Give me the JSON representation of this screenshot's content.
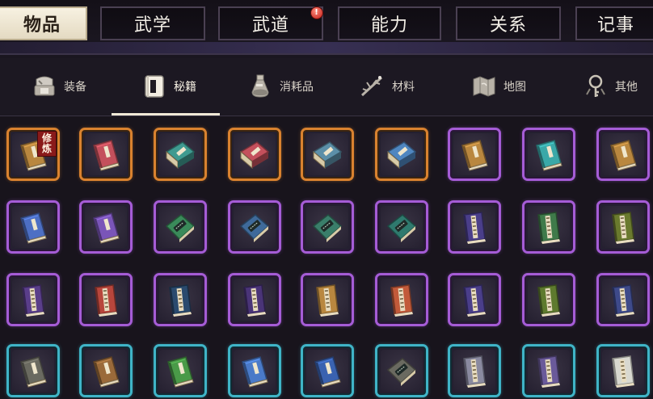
{
  "top_tabs": [
    {
      "label": "物品",
      "active": true
    },
    {
      "label": "武学",
      "active": false
    },
    {
      "label": "武道",
      "active": false,
      "badge": "!"
    },
    {
      "label": "能力",
      "active": false
    },
    {
      "label": "关系",
      "active": false
    },
    {
      "label": "记事",
      "active": false
    }
  ],
  "categories": [
    {
      "label": "装备",
      "icon": "equipment-icon",
      "active": false
    },
    {
      "label": "秘籍",
      "icon": "scroll-book-icon",
      "active": true
    },
    {
      "label": "消耗品",
      "icon": "potion-icon",
      "active": false
    },
    {
      "label": "材料",
      "icon": "herb-icon",
      "active": false
    },
    {
      "label": "地图",
      "icon": "map-icon",
      "active": false
    },
    {
      "label": "其他",
      "icon": "key-ring-icon",
      "active": false
    }
  ],
  "items": [
    {
      "rarity": "orange",
      "style": "thin",
      "cover": "#b9873f",
      "tag": "修炼"
    },
    {
      "rarity": "orange",
      "style": "thin",
      "cover": "#c4505c"
    },
    {
      "rarity": "orange",
      "style": "thick",
      "cover": "#3f9a90"
    },
    {
      "rarity": "orange",
      "style": "thick",
      "cover": "#c4505c"
    },
    {
      "rarity": "orange",
      "style": "thick",
      "cover": "#5c8fa8"
    },
    {
      "rarity": "orange",
      "style": "thick",
      "cover": "#4f86c0"
    },
    {
      "rarity": "purple",
      "style": "thin",
      "cover": "#b9873f"
    },
    {
      "rarity": "purple",
      "style": "thin",
      "cover": "#3aa8a8"
    },
    {
      "rarity": "purple",
      "style": "thin",
      "cover": "#b9873f"
    },
    {
      "rarity": "purple",
      "style": "thin",
      "cover": "#4d6fc4"
    },
    {
      "rarity": "purple",
      "style": "thin",
      "cover": "#7a55b8"
    },
    {
      "rarity": "purple",
      "style": "plate",
      "cover": "#3a8a5a"
    },
    {
      "rarity": "purple",
      "style": "plate",
      "cover": "#3f6a9a"
    },
    {
      "rarity": "purple",
      "style": "plate",
      "cover": "#3a7e6a"
    },
    {
      "rarity": "purple",
      "style": "plate",
      "cover": "#2f7a6e"
    },
    {
      "rarity": "purple",
      "style": "stitch",
      "cover": "#4a3e8a"
    },
    {
      "rarity": "purple",
      "style": "stitch",
      "cover": "#3f7a4a"
    },
    {
      "rarity": "purple",
      "style": "stitch",
      "cover": "#6a7a2e"
    },
    {
      "rarity": "purple",
      "style": "stitch",
      "cover": "#5a3e8a"
    },
    {
      "rarity": "purple",
      "style": "stitch",
      "cover": "#b8463c"
    },
    {
      "rarity": "purple",
      "style": "stitch",
      "cover": "#2a4a6e"
    },
    {
      "rarity": "purple",
      "style": "stitch",
      "cover": "#4a3478"
    },
    {
      "rarity": "purple",
      "style": "stitch",
      "cover": "#b9873f"
    },
    {
      "rarity": "purple",
      "style": "stitch",
      "cover": "#c25a3a"
    },
    {
      "rarity": "purple",
      "style": "stitch",
      "cover": "#4a3e8a"
    },
    {
      "rarity": "purple",
      "style": "stitch",
      "cover": "#5e7a2e"
    },
    {
      "rarity": "purple",
      "style": "stitch",
      "cover": "#3e4a8a"
    },
    {
      "rarity": "cyan",
      "style": "thin",
      "cover": "#6a6a60"
    },
    {
      "rarity": "cyan",
      "style": "thin",
      "cover": "#9a6a3a"
    },
    {
      "rarity": "cyan",
      "style": "thin",
      "cover": "#4a9a48"
    },
    {
      "rarity": "cyan",
      "style": "thin",
      "cover": "#4a7ac8"
    },
    {
      "rarity": "cyan",
      "style": "thin",
      "cover": "#3a62b0"
    },
    {
      "rarity": "cyan",
      "style": "plate",
      "cover": "#6a6a60"
    },
    {
      "rarity": "cyan",
      "style": "stitch",
      "cover": "#8a8aa0"
    },
    {
      "rarity": "cyan",
      "style": "stitch",
      "cover": "#6a5a9a"
    },
    {
      "rarity": "cyan",
      "style": "stitch",
      "cover": "#d8d8d0"
    }
  ]
}
